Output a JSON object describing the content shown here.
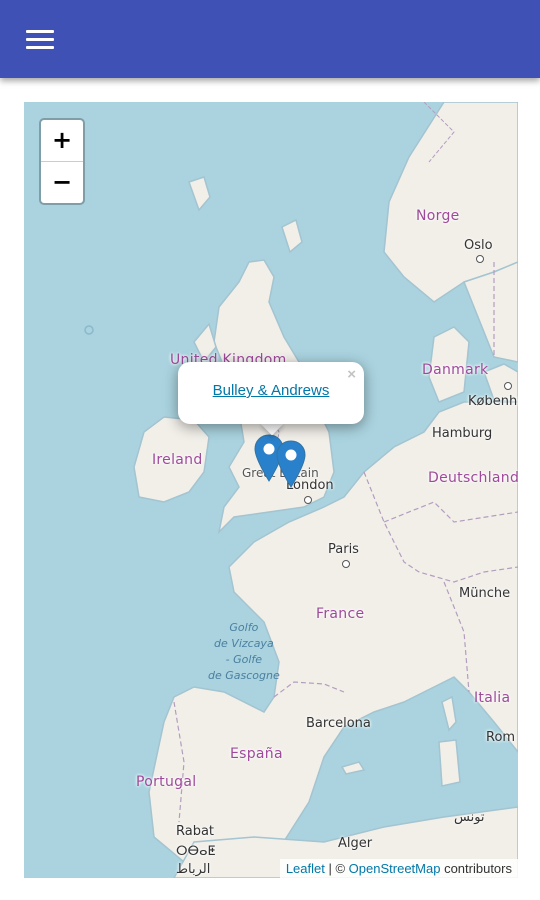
{
  "app_bar": {
    "menu_icon": "menu-icon",
    "color": "#3f51b5"
  },
  "map": {
    "zoom_in_label": "+",
    "zoom_out_label": "−",
    "popup": {
      "link_text": "Bulley & Andrews",
      "close_label": "×"
    },
    "marker_color": "#2a81cb",
    "markers_count": 2,
    "labels": {
      "norge": "Norge",
      "oslo": "Oslo",
      "united_kingdom": "United Kingdom",
      "danmark": "Danmark",
      "kobenhavn": "København",
      "hamburg": "Hamburg",
      "ireland": "Ireland",
      "great_britain": "Great Britain",
      "london": "London",
      "deutschland": "Deutschland",
      "paris": "Paris",
      "munchen": "Münche",
      "france": "France",
      "sea_1": "Golfo",
      "sea_2": "de Vizcaya",
      "sea_3": "- Golfe",
      "sea_4": "de Gascogne",
      "italia": "Italia",
      "roma": "Rom",
      "barcelona": "Barcelona",
      "espana": "España",
      "portugal": "Portugal",
      "rabat": "Rabat",
      "rabat_tifinagh": "ⵔⴱⴰⵟ",
      "rabat_arabic": "الرباط",
      "alger": "Alger",
      "tunis": "تونس"
    },
    "attribution": {
      "leaflet": "Leaflet",
      "separator": " | © ",
      "osm": "OpenStreetMap",
      "suffix": " contributors"
    }
  }
}
